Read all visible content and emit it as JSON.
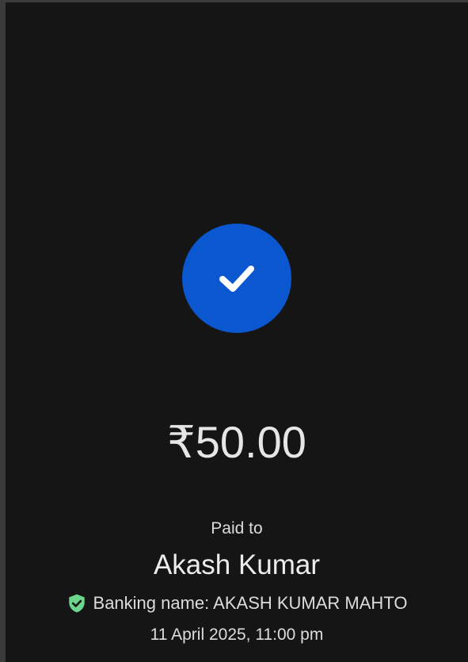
{
  "payment": {
    "status_icon": "check-circle-icon",
    "amount": "₹50.00",
    "paid_to_label": "Paid to",
    "payee_name": "Akash Kumar",
    "verified_icon": "verified-shield-icon",
    "banking_name_text": "Banking name: AKASH KUMAR MAHTO",
    "timestamp": "11 April 2025, 11:00 pm"
  },
  "colors": {
    "background": "#151515",
    "accent_blue": "#0b57d0",
    "verified_green": "#6dd58c",
    "text_primary": "#e6e6e6"
  }
}
